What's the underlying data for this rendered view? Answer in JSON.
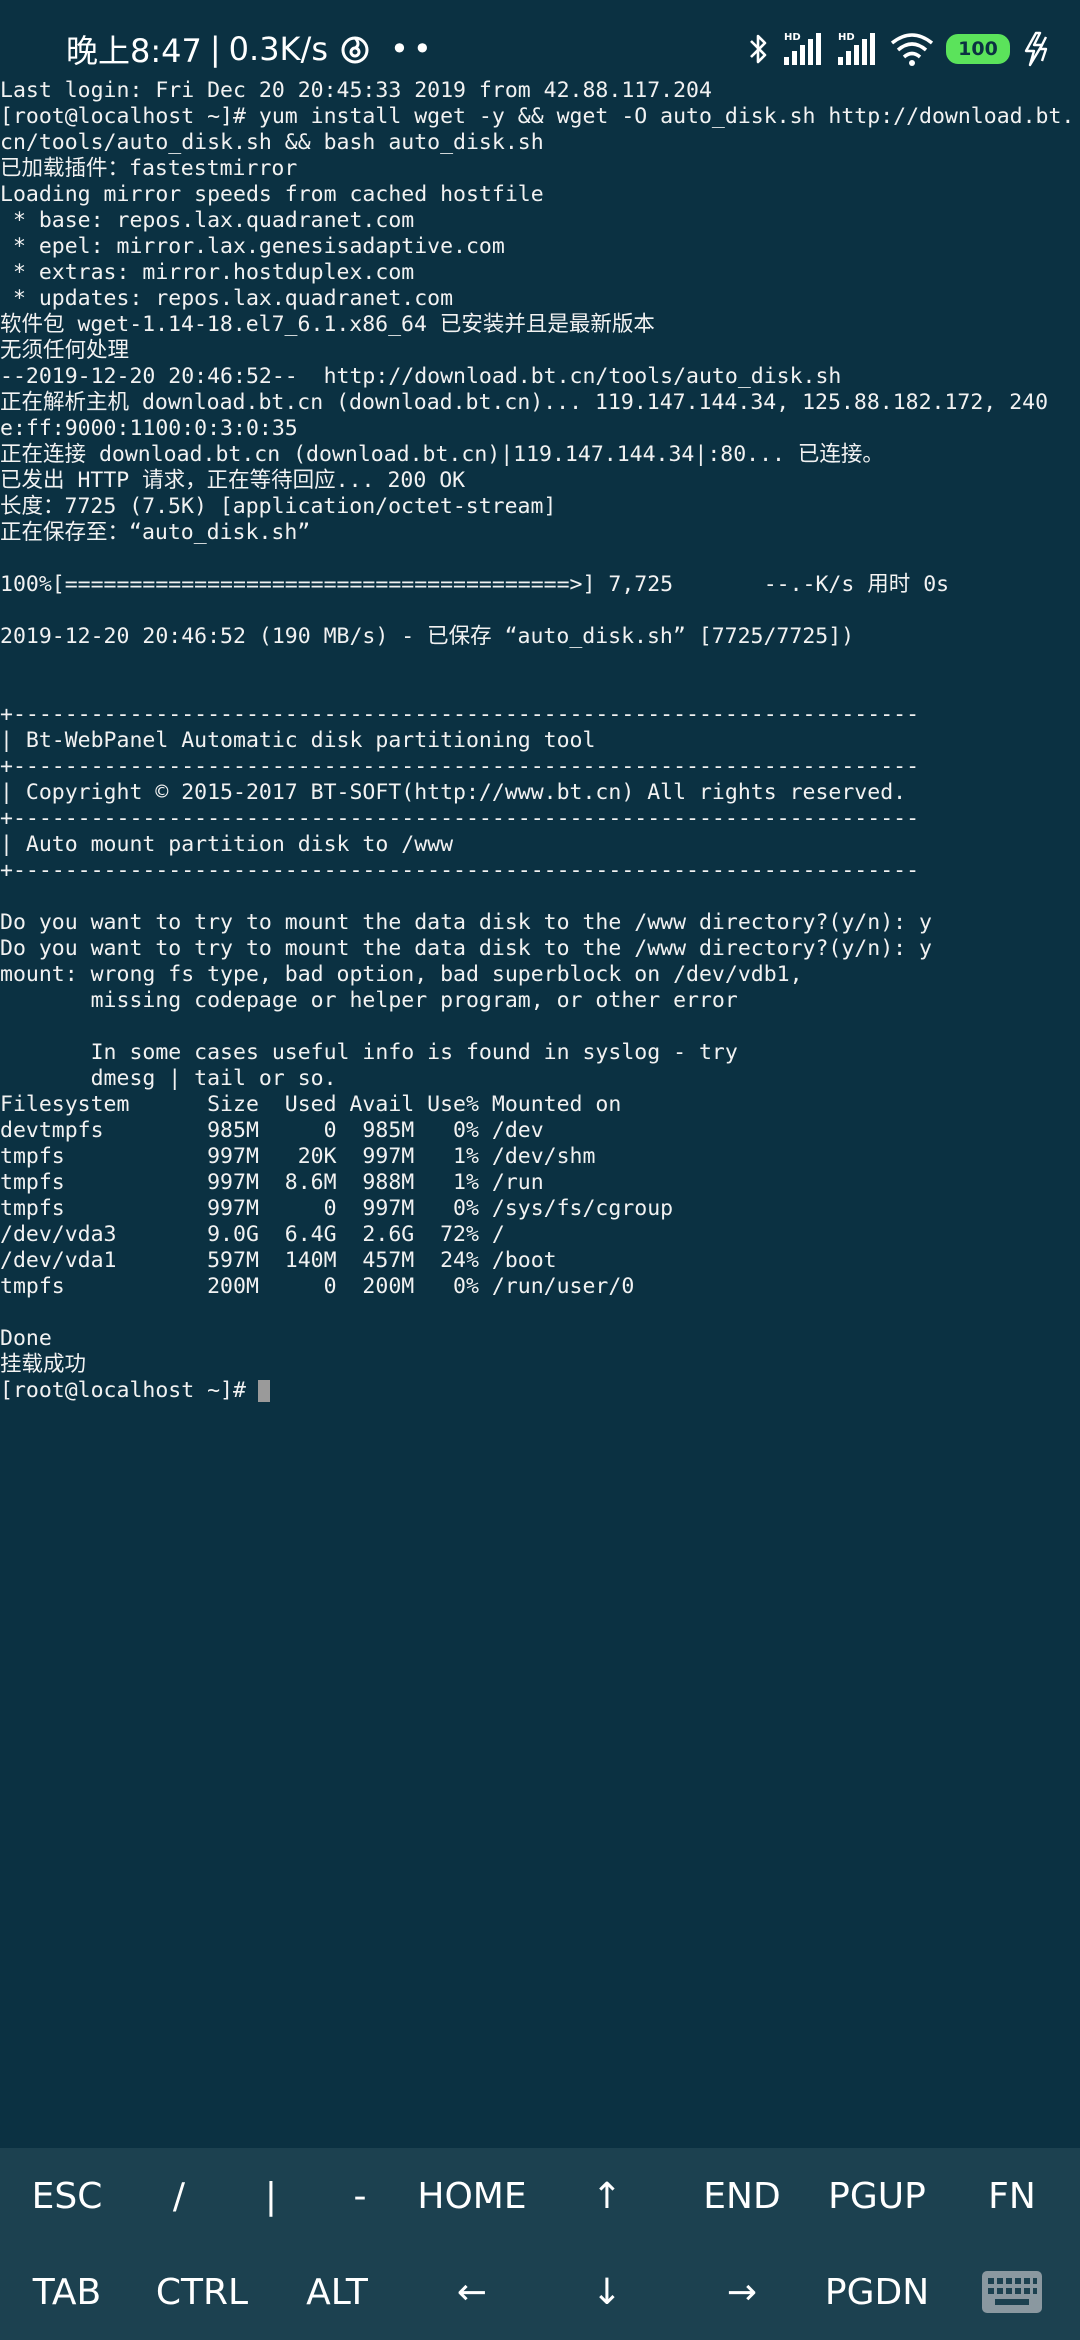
{
  "status_bar": {
    "time": "晚上8:47",
    "speed": "0.3K/s",
    "battery": "100",
    "icons": [
      "network-activity-icon",
      "bluetooth-icon",
      "hd-signal-icon",
      "hd-signal-icon",
      "wifi-icon",
      "battery-icon",
      "charging-icon"
    ],
    "battery_color": "#5be35b"
  },
  "terminal": {
    "background": "#0b3142",
    "lines": [
      "Last login: Fri Dec 20 20:45:33 2019 from 42.88.117.204",
      "[root@localhost ~]# yum install wget -y && wget -O auto_disk.sh http://download.bt.",
      "cn/tools/auto_disk.sh && bash auto_disk.sh",
      "已加载插件：fastestmirror",
      "Loading mirror speeds from cached hostfile",
      " * base: repos.lax.quadranet.com",
      " * epel: mirror.lax.genesisadaptive.com",
      " * extras: mirror.hostduplex.com",
      " * updates: repos.lax.quadranet.com",
      "软件包 wget-1.14-18.el7_6.1.x86_64 已安装并且是最新版本",
      "无须任何处理",
      "--2019-12-20 20:46:52--  http://download.bt.cn/tools/auto_disk.sh",
      "正在解析主机 download.bt.cn (download.bt.cn)... 119.147.144.34, 125.88.182.172, 240",
      "e:ff:9000:1100:0:3:0:35",
      "正在连接 download.bt.cn (download.bt.cn)|119.147.144.34|:80... 已连接。",
      "已发出 HTTP 请求，正在等待回应... 200 OK",
      "长度：7725 (7.5K) [application/octet-stream]",
      "正在保存至：“auto_disk.sh”",
      "",
      "100%[=======================================>] 7,725       --.-K/s 用时 0s",
      "",
      "2019-12-20 20:46:52 (190 MB/s) - 已保存 “auto_disk.sh” [7725/7725])",
      "",
      "",
      "+----------------------------------------------------------------------",
      "| Bt-WebPanel Automatic disk partitioning tool",
      "+----------------------------------------------------------------------",
      "| Copyright © 2015-2017 BT-SOFT(http://www.bt.cn) All rights reserved.",
      "+----------------------------------------------------------------------",
      "| Auto mount partition disk to /www",
      "+----------------------------------------------------------------------",
      "",
      "Do you want to try to mount the data disk to the /www directory?(y/n): y",
      "Do you want to try to mount the data disk to the /www directory?(y/n): y",
      "mount: wrong fs type, bad option, bad superblock on /dev/vdb1,",
      "       missing codepage or helper program, or other error",
      "",
      "       In some cases useful info is found in syslog - try",
      "       dmesg | tail or so.",
      "Filesystem      Size  Used Avail Use% Mounted on",
      "devtmpfs        985M     0  985M   0% /dev",
      "tmpfs           997M   20K  997M   1% /dev/shm",
      "tmpfs           997M  8.6M  988M   1% /run",
      "tmpfs           997M     0  997M   0% /sys/fs/cgroup",
      "/dev/vda3       9.0G  6.4G  2.6G  72% /",
      "/dev/vda1       597M  140M  457M  24% /boot",
      "tmpfs           200M     0  200M   0% /run/user/0",
      "",
      "Done",
      "挂载成功"
    ],
    "prompt": "[root@localhost ~]#"
  },
  "extra_keys": {
    "row1": [
      "ESC",
      "/",
      "|",
      "-",
      "HOME",
      "↑",
      "END",
      "PGUP",
      "FN"
    ],
    "row2": [
      "TAB",
      "CTRL",
      "ALT",
      "←",
      "↓",
      "→",
      "PGDN"
    ],
    "row2_last_icon": "keyboard-icon"
  }
}
